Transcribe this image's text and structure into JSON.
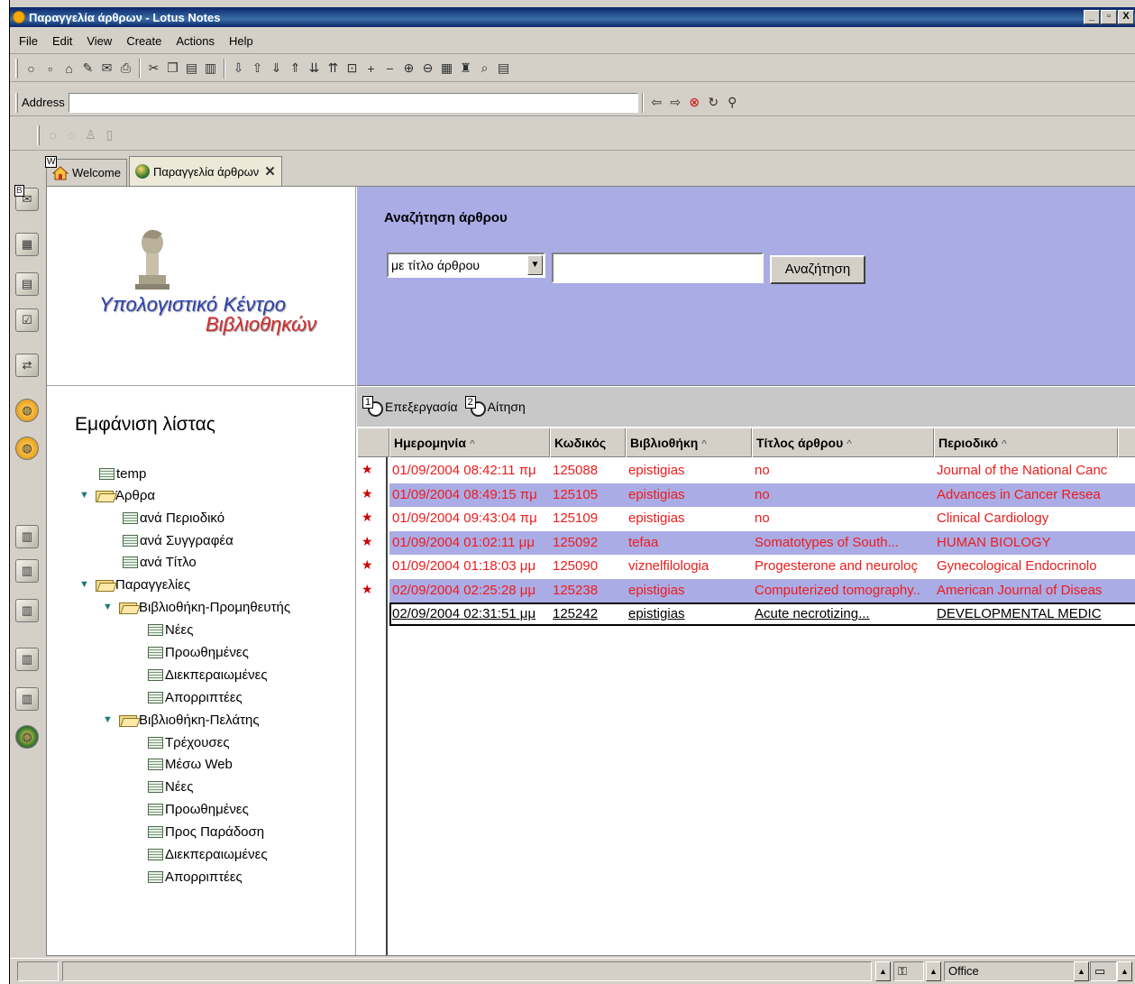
{
  "window": {
    "title": "Παραγγελία άρθρων - Lotus Notes",
    "controls": [
      "_",
      "▫",
      "X"
    ]
  },
  "menu": [
    "File",
    "Edit",
    "View",
    "Create",
    "Actions",
    "Help"
  ],
  "address_bar": {
    "label": "Address",
    "value": ""
  },
  "tabs": [
    {
      "label": "Welcome",
      "badge": "W"
    },
    {
      "label": "Παραγγελία άρθρων"
    }
  ],
  "sidebar": {
    "icons": [
      "mail-icon",
      "calendar-icon",
      "address-book-icon",
      "todo-icon",
      "replicator-icon",
      "world-icon",
      "world-icon-2",
      "database-icon",
      "database-icon-2",
      "database-icon-3",
      "database-icon-4",
      "database-icon-5",
      "globe-people-icon"
    ],
    "badge_b": "B"
  },
  "logo": {
    "line1": "Υπολογιστικό Κέντρο",
    "line2": "Βιβλιοθηκών"
  },
  "navigation": {
    "title": "Εμφάνιση λίστας",
    "items": [
      {
        "label": "temp",
        "kind": "view",
        "level": 0
      },
      {
        "label": "Άρθρα",
        "kind": "folder",
        "level": 0
      },
      {
        "label": "ανά Περιοδικό",
        "kind": "view",
        "level": 1
      },
      {
        "label": "ανά Συγγραφέα",
        "kind": "view",
        "level": 1
      },
      {
        "label": "ανά Τίτλο",
        "kind": "view",
        "level": 1
      },
      {
        "label": "Παραγγελίες",
        "kind": "folder",
        "level": 0
      },
      {
        "label": "Βιβλιοθήκη-Προμηθευτής",
        "kind": "folder",
        "level": 1
      },
      {
        "label": "Νέες",
        "kind": "view",
        "level": 2
      },
      {
        "label": "Προωθημένες",
        "kind": "view",
        "level": 2
      },
      {
        "label": "Διεκπεραιωμένες",
        "kind": "view",
        "level": 2
      },
      {
        "label": "Απορριπτέες",
        "kind": "view",
        "level": 2
      },
      {
        "label": "Βιβλιοθήκη-Πελάτης",
        "kind": "folder",
        "level": 1
      },
      {
        "label": "Τρέχουσες",
        "kind": "view",
        "level": 2
      },
      {
        "label": "Μέσω Web",
        "kind": "view",
        "level": 2
      },
      {
        "label": "Νέες",
        "kind": "view",
        "level": 2
      },
      {
        "label": "Προωθημένες",
        "kind": "view",
        "level": 2
      },
      {
        "label": "Προς Παράδοση",
        "kind": "view",
        "level": 2
      },
      {
        "label": "Διεκπεραιωμένες",
        "kind": "view",
        "level": 2
      },
      {
        "label": "Απορριπτέες",
        "kind": "view",
        "level": 2
      }
    ]
  },
  "search": {
    "title": "Αναζήτηση άρθρου",
    "select_value": "με τίτλο άρθρου",
    "input_value": "",
    "button_label": "Αναζήτηση",
    "background": "#aaace6"
  },
  "actions": [
    {
      "number": "1",
      "label": "Επεξεργασία"
    },
    {
      "number": "2",
      "label": "Αίτηση"
    }
  ],
  "table": {
    "columns": [
      {
        "label": "Ημερομηνία",
        "sort": "^"
      },
      {
        "label": "Κωδικός",
        "sort": ""
      },
      {
        "label": "Βιβλιοθήκη",
        "sort": "^"
      },
      {
        "label": "Τίτλος άρθρου",
        "sort": "^"
      },
      {
        "label": "Περιοδικό",
        "sort": "^"
      }
    ],
    "rows": [
      {
        "unread": true,
        "date": "01/09/2004 08:42:11 πμ",
        "code": "125088",
        "library": "epistigias",
        "title": "no",
        "journal": "Journal of the National Canc"
      },
      {
        "unread": true,
        "date": "01/09/2004 08:49:15 πμ",
        "code": "125105",
        "library": "epistigias",
        "title": "no",
        "journal": "Advances in Cancer Resea"
      },
      {
        "unread": true,
        "date": "01/09/2004 09:43:04 πμ",
        "code": "125109",
        "library": "epistigias",
        "title": "no",
        "journal": "Clinical Cardiology"
      },
      {
        "unread": true,
        "date": "01/09/2004 01:02:11 μμ",
        "code": "125092",
        "library": "tefaa",
        "title": "Somatotypes of South...",
        "journal": "HUMAN BIOLOGY"
      },
      {
        "unread": true,
        "date": "01/09/2004 01:18:03 μμ",
        "code": "125090",
        "library": "viznelfilologia",
        "title": " Progesterone and neuroloç",
        "journal": "Gynecological Endocrinolo"
      },
      {
        "unread": true,
        "date": "02/09/2004 02:25:28 μμ",
        "code": "125238",
        "library": "epistigias",
        "title": "Computerized tomography..",
        "journal": "American Journal of Diseas"
      },
      {
        "unread": false,
        "date": "02/09/2004 02:31:51 μμ",
        "code": "125242",
        "library": "epistigias",
        "title": "Acute necrotizing...",
        "journal": "DEVELOPMENTAL MEDIC"
      }
    ],
    "unread_color": "#ee1c1c",
    "alt_row_color": "#aaace6"
  },
  "statusbar": {
    "location": "Office"
  }
}
